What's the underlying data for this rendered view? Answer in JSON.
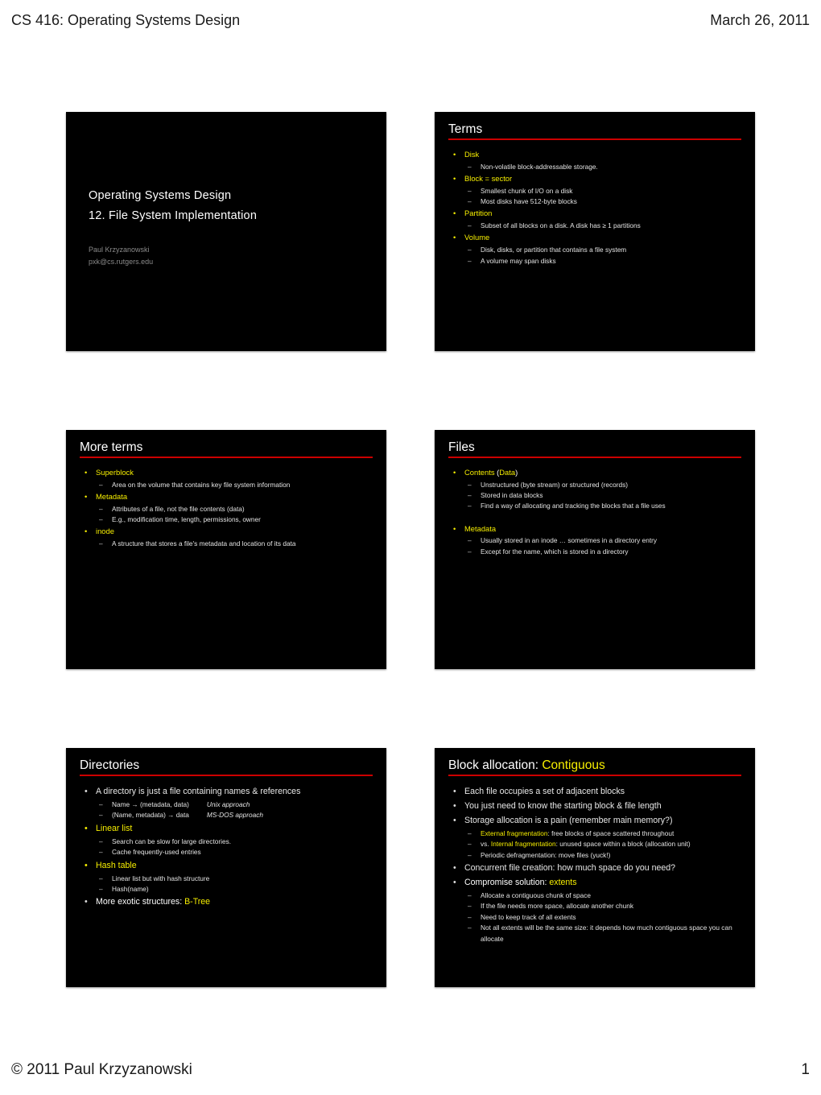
{
  "page": {
    "header_left": "CS 416: Operating Systems Design",
    "header_right": "March 26, 2011",
    "footer_left": "© 2011 Paul Krzyzanowski",
    "footer_right": "1"
  },
  "colors": {
    "slide_background": "#000000",
    "rule": "#cc0000",
    "accent_yellow": "#f6ee00",
    "body_white": "#e8e8e8",
    "author_gray": "#8a8a8a"
  },
  "slides": [
    {
      "kind": "title",
      "line1": "Operating Systems Design",
      "line2": "12. File System Implementation",
      "author": "Paul Krzyzanowski",
      "email": "pxk@cs.rutgers.edu"
    },
    {
      "kind": "content",
      "title": "Terms",
      "title_accent": "",
      "bullets": [
        {
          "text": "Disk",
          "color": "yellow",
          "sub": [
            "Non-volatile block-addressable storage."
          ]
        },
        {
          "text": "Block = sector",
          "color": "yellow",
          "sub": [
            "Smallest chunk of I/O on a disk",
            "Most disks have 512-byte blocks"
          ]
        },
        {
          "text": "Partition",
          "color": "yellow",
          "sub": [
            "Subset of all blocks on a disk. A disk has ≥ 1 partitions"
          ]
        },
        {
          "text": "Volume",
          "color": "yellow",
          "sub": [
            "Disk, disks, or partition that contains a file system",
            "A volume may span disks"
          ]
        }
      ]
    },
    {
      "kind": "content",
      "title": "More terms",
      "title_accent": "",
      "bullets": [
        {
          "text": "Superblock",
          "color": "yellow",
          "sub": [
            "Area on the volume that contains key file system information"
          ]
        },
        {
          "text": "Metadata",
          "color": "yellow",
          "sub": [
            "Attributes of a file, not the file contents (data)",
            "E.g., modification time, length, permissions, owner"
          ]
        },
        {
          "text": "inode",
          "color": "yellow",
          "sub": [
            "A structure that stores a file's metadata and location of its data"
          ]
        }
      ]
    },
    {
      "kind": "content",
      "title": "Files",
      "title_accent": "",
      "bullets": [
        {
          "text": "Contents (Data)",
          "color": "mixed",
          "parts": [
            {
              "t": "Contents ",
              "c": "yellow"
            },
            {
              "t": "(",
              "c": "white"
            },
            {
              "t": "Data",
              "c": "yellow"
            },
            {
              "t": ")",
              "c": "white"
            }
          ],
          "sub": [
            "Unstructured (byte stream) or structured (records)",
            "Stored in data blocks",
            "Find a way of allocating and tracking the blocks that a file uses"
          ]
        },
        {
          "text": "Metadata",
          "color": "yellow",
          "spacer_before": true,
          "sub": [
            "Usually stored in an inode … sometimes in a directory entry",
            "Except for the name, which is stored in a directory"
          ]
        }
      ]
    },
    {
      "kind": "content",
      "title": "Directories",
      "title_accent": "",
      "bullets": [
        {
          "text": "A directory is just a file containing names & references",
          "color": "white",
          "big": true,
          "sub_rich": [
            [
              {
                "t": "Name → (metadata, data)",
                "c": "plain"
              },
              {
                "t": "gap"
              },
              {
                "t": "Unix approach",
                "c": "ital"
              }
            ],
            [
              {
                "t": "(Name, metadata) → data",
                "c": "plain"
              },
              {
                "t": "gap"
              },
              {
                "t": "MS-DOS approach",
                "c": "ital"
              }
            ]
          ]
        },
        {
          "text": "Linear list",
          "color": "yellow",
          "big": true,
          "sub": [
            "Search can be slow for large directories.",
            "Cache frequently-used entries"
          ]
        },
        {
          "text": "Hash table",
          "color": "yellow",
          "big": true,
          "sub": [
            "Linear list but with hash structure",
            "Hash(name)"
          ]
        },
        {
          "text": "More exotic structures: B-Tree",
          "color": "mixed",
          "big": true,
          "parts": [
            {
              "t": "More exotic structures: ",
              "c": "white"
            },
            {
              "t": "B-Tree",
              "c": "yellow"
            }
          ],
          "sub": []
        }
      ]
    },
    {
      "kind": "content",
      "title": "Block allocation: ",
      "title_accent": "Contiguous",
      "bullets": [
        {
          "text": "Each file occupies a set of adjacent blocks",
          "color": "white",
          "dot": "white",
          "sub": []
        },
        {
          "text": "You just need to know the starting block & file length",
          "color": "white",
          "dot": "white",
          "sub": []
        },
        {
          "text": "Storage allocation is a pain (remember main memory?)",
          "color": "white",
          "dot": "white",
          "sub_rich": [
            [
              {
                "t": "External fragmentation",
                "c": "yellow"
              },
              {
                "t": ": free blocks of space scattered throughout",
                "c": "plain"
              }
            ],
            [
              {
                "t": "vs. ",
                "c": "plain"
              },
              {
                "t": "Internal fragmentation",
                "c": "yellow"
              },
              {
                "t": ": unused  space within a block (allocation unit)",
                "c": "plain"
              }
            ],
            [
              {
                "t": "Periodic defragmentation: move files (yuck!)",
                "c": "plain"
              }
            ]
          ]
        },
        {
          "text": "Concurrent file creation: how much space do you need?",
          "color": "white",
          "dot": "white",
          "sub": []
        },
        {
          "text": "Compromise solution: extents",
          "color": "mixed",
          "dot": "white",
          "parts": [
            {
              "t": "Compromise solution: ",
              "c": "white"
            },
            {
              "t": "extents",
              "c": "yellow"
            }
          ],
          "sub": [
            "Allocate a contiguous chunk of space",
            "If the file needs more space, allocate another chunk",
            "Need to keep track of all extents",
            "Not all extents will be the same size: it depends how much contiguous space you can allocate"
          ]
        }
      ]
    }
  ]
}
